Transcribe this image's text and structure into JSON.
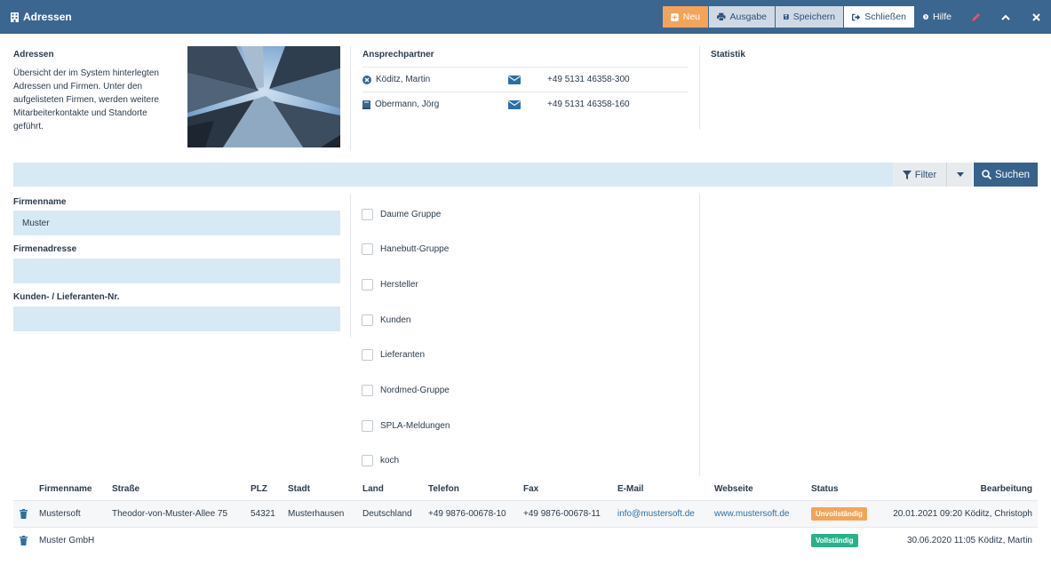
{
  "header": {
    "title": "Adressen",
    "buttons": {
      "neu": "Neu",
      "ausgabe": "Ausgabe",
      "speichern": "Speichern",
      "schliessen": "Schließen",
      "hilfe": "Hilfe"
    }
  },
  "info": {
    "title": "Adressen",
    "text": "Übersicht der im System hinterlegten Adressen und Firmen. Unter den aufgelisteten Firmen, werden weitere Mitarbeiterkontakte und Standorte geführt."
  },
  "ansprechpartner": {
    "title": "Ansprechpartner",
    "contacts": [
      {
        "name": "Köditz, Martin",
        "icon": "close-circle-icon",
        "phone": "+49 5131 46358-300"
      },
      {
        "name": "Obermann, Jörg",
        "icon": "book-icon",
        "phone": "+49 5131 46358-160"
      }
    ]
  },
  "statistik": {
    "title": "Statistik"
  },
  "search": {
    "placeholder": "",
    "filter_label": "Filter",
    "search_label": "Suchen"
  },
  "form": {
    "firmenname_label": "Firmenname",
    "firmenname_value": "Muster",
    "firmenadresse_label": "Firmenadresse",
    "firmenadresse_value": "",
    "kundennr_label": "Kunden- / Lieferanten-Nr.",
    "kundennr_value": ""
  },
  "groups": [
    "Daume Gruppe",
    "Hanebutt-Gruppe",
    "Hersteller",
    "Kunden",
    "Lieferanten",
    "Nordmed-Gruppe",
    "SPLA-Meldungen",
    "koch"
  ],
  "table": {
    "headers": {
      "firmenname": "Firmenname",
      "strasse": "Straße",
      "plz": "PLZ",
      "stadt": "Stadt",
      "land": "Land",
      "telefon": "Telefon",
      "fax": "Fax",
      "email": "E-Mail",
      "webseite": "Webseite",
      "status": "Status",
      "bearbeitung": "Bearbeitung"
    },
    "rows": [
      {
        "firmenname": "Mustersoft",
        "strasse": "Theodor-von-Muster-Allee 75",
        "plz": "54321",
        "stadt": "Musterhausen",
        "land": "Deutschland",
        "telefon": "+49 9876-00678-10",
        "fax": "+49 9876-00678-11",
        "email": "info@mustersoft.de",
        "webseite": "www.mustersoft.de",
        "status": "Unvollständig",
        "bearbeitung": "20.01.2021 09:20 Köditz, Christoph"
      },
      {
        "firmenname": "Muster GmbH",
        "strasse": "",
        "plz": "",
        "stadt": "",
        "land": "",
        "telefon": "",
        "fax": "",
        "email": "",
        "webseite": "",
        "status": "Vollständig",
        "bearbeitung": "30.06.2020 11:05 Köditz, Martin"
      }
    ]
  },
  "colors": {
    "header_bg": "#3b6690",
    "accent_orange": "#f3a45a",
    "accent_green": "#27b38a",
    "input_bg": "#d7e9f5",
    "link": "#2f6ea5"
  }
}
